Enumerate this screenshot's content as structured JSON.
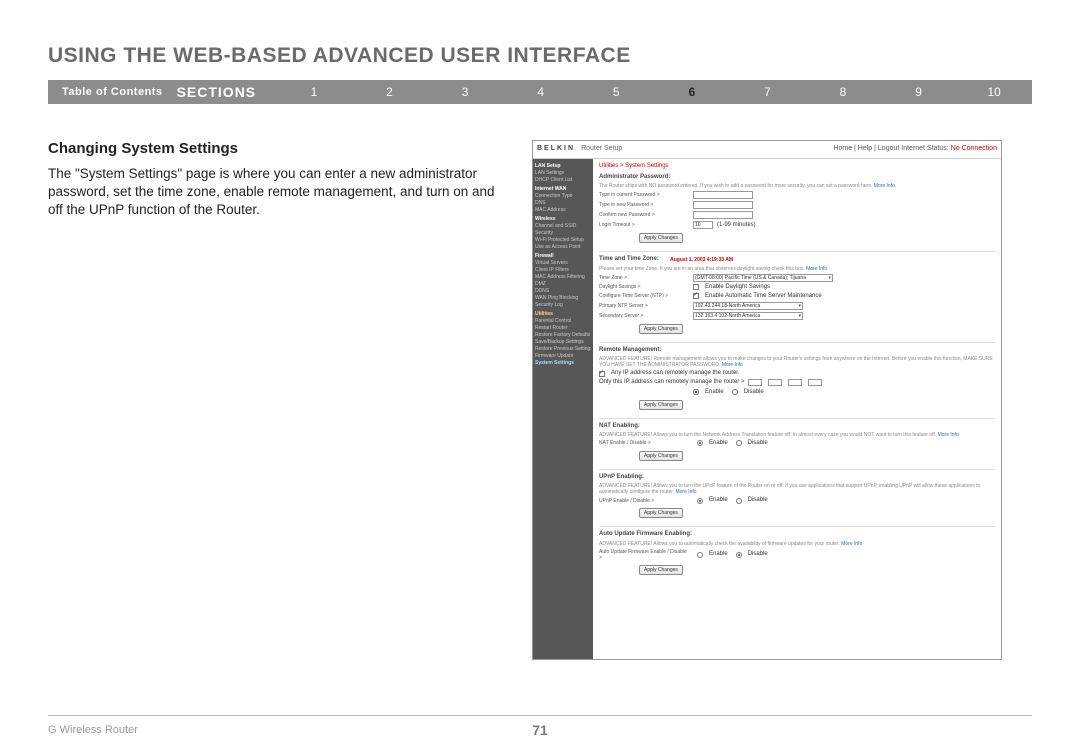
{
  "title": "USING THE WEB-BASED ADVANCED USER INTERFACE",
  "nav": {
    "toc": "Table of Contents",
    "sections_label": "SECTIONS",
    "nums": [
      "1",
      "2",
      "3",
      "4",
      "5",
      "6",
      "7",
      "8",
      "9",
      "10"
    ],
    "current": "6"
  },
  "left": {
    "heading": "Changing System Settings",
    "para": "The \"System Settings\" page is where you can enter a new administrator password, set the time zone, enable remote management, and turn on and off the UPnP function of the Router."
  },
  "shot": {
    "brand": "BELKIN",
    "brand_sub": "Router Setup",
    "hdr_links": "Home | Help | Logout   Internet Status:",
    "status": "No Connection",
    "side": {
      "g1": "LAN Setup",
      "g1_items": [
        "LAN Settings",
        "DHCP Client List"
      ],
      "g2": "Internet WAN",
      "g2_items": [
        "Connection Type",
        "DNS",
        "MAC Address"
      ],
      "g3": "Wireless",
      "g3_items": [
        "Channel and SSID",
        "Security",
        "Wi-Fi Protected Setup",
        "Use as Access Point"
      ],
      "g4": "Firewall",
      "g4_items": [
        "Virtual Servers",
        "Client IP Filters",
        "MAC Address Filtering",
        "DMZ",
        "DDNS",
        "WAN Ping Blocking",
        "Security Log"
      ],
      "g5": "Utilities",
      "g5_items": [
        "Parental Control",
        "Restart Router",
        "Restore Factory Defaults",
        "Save/Backup Settings",
        "Restore Previous Settings",
        "Firmware Update",
        "System Settings"
      ]
    },
    "crumb": "Utilities > System Settings",
    "admin": {
      "h": "Administrator Password:",
      "d": "The Router ships with NO password entered. If you wish to add a password for more security, you can set a password here. ",
      "more": "More Info",
      "r1": "Type in current Password >",
      "r2": "Type in new Password >",
      "r3": "Confirm new Password >",
      "r4": "Login Timeout >",
      "timeout_val": "10",
      "timeout_note": "(1-99 minutes)",
      "btn": "Apply Changes"
    },
    "time": {
      "h": "Time and Time Zone:",
      "date": "August 1, 2003  4:19:33 AM",
      "d": "Please set your time Zone. If you are in an area that observes daylight saving check this box. ",
      "more": "More Info",
      "tz_l": "Time Zone >",
      "tz_v": "(GMT-08:00) Pacific Time (US & Canada); Tijuana",
      "ds_l": "Daylight Savings >",
      "ds_v": "Enable Daylight Savings",
      "ts_l": "Configure Time Server (NTP) >",
      "ts_v": "Enable Automatic Time Server Maintenance",
      "p_l": "Primary NTP Server >",
      "p_v": "192.43.244.18-North America",
      "s_l": "Secondary Server >",
      "s_v": "132.163.4.102-North America",
      "btn": "Apply Changes"
    },
    "remote": {
      "h": "Remote Management:",
      "d": "ADVANCED FEATURE! Remote management allows you to make changes to your Router's settings from anywhere on the Internet. Before you enable this function, MAKE SURE YOU HAVE SET THE ADMINISTRATOR PASSWORD. ",
      "more": "More Info",
      "c1": "Any IP address can remotely manage the router.",
      "c2": "Only this IP address can remotely manage the router >",
      "en": "Enable",
      "dis": "Disable",
      "btn": "Apply Changes"
    },
    "nat": {
      "h": "NAT Enabling:",
      "d": "ADVANCED FEATURE! Allows you to turn the Network Address Translation feature off. In almost every case you would NOT want to turn this feature off. ",
      "more": "More Info",
      "l": "NAT Enable / Disable >",
      "en": "Enable",
      "dis": "Disable",
      "btn": "Apply Changes"
    },
    "upnp": {
      "h": "UPnP Enabling:",
      "d": "ADVANCED FEATURE! Allows you to turn the UPnP feature of the Router on or off. If you use applications that support UPnP, enabling UPnP will allow these applications to automatically configure the router. ",
      "more": "More Info",
      "l": "UPnP Enable / Disable >",
      "en": "Enable",
      "dis": "Disable",
      "btn": "Apply Changes"
    },
    "fw": {
      "h": "Auto Update Firmware Enabling:",
      "d": "ADVANCED FEATURE! Allows you to automatically check the availability of firmware updates for your router. ",
      "more": "More Info",
      "l": "Auto Update Firmware Enable / Disable >",
      "en": "Enable",
      "dis": "Disable",
      "btn": "Apply Changes"
    }
  },
  "footer": {
    "left": "G Wireless Router",
    "page": "71"
  }
}
